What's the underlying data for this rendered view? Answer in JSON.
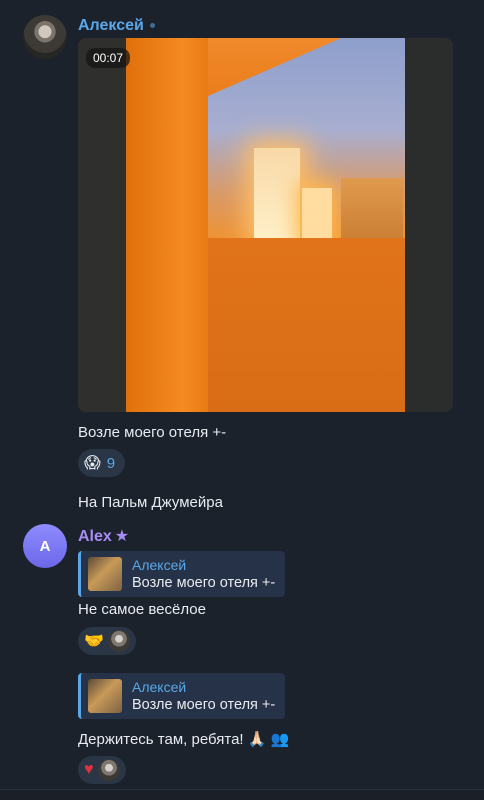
{
  "messages": [
    {
      "sender": "Алексей",
      "video_duration": "00:07",
      "caption": "Возле моего отеля +-",
      "reaction": {
        "emoji": "😱",
        "count": "9"
      },
      "followup": "На Пальм Джумейра"
    },
    {
      "sender": "Alex",
      "avatar_letter": "A",
      "replies": [
        {
          "quote_author": "Алексей",
          "quote_text": "Возле моего отеля +-",
          "text": "Не самое весёлое",
          "reaction_emoji": "🤝"
        },
        {
          "quote_author": "Алексей",
          "quote_text": "Возле моего отеля +-",
          "text": "Держитесь там, ребята! 🙏🏻 👥",
          "reaction_emoji": "♥"
        }
      ]
    }
  ],
  "colors": {
    "background": "#1c222c",
    "accent_blue": "#5aa8ea",
    "accent_purple": "#a68cf5",
    "reply_bg": "#253247"
  }
}
